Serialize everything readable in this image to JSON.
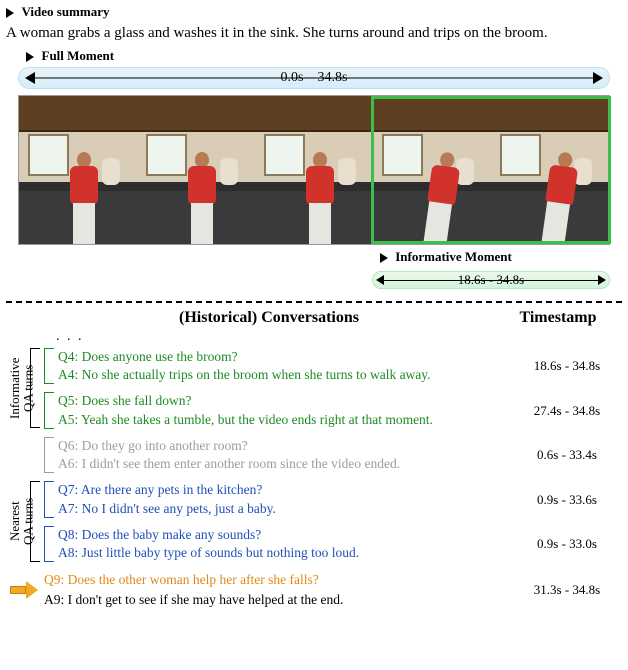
{
  "labels": {
    "video_summary": "Video summary",
    "full_moment": "Full Moment",
    "informative_moment": "Informative Moment"
  },
  "summary_text": "A woman grabs a glass and washes it in the sink. She turns around and trips on the broom.",
  "full_moment_range": "0.0s – 34.8s",
  "informative_moment_range": "18.6s - 34.8s",
  "columns": {
    "conversations": "(Historical) Conversations",
    "timestamp": "Timestamp"
  },
  "groups": {
    "informative_label": "Informative\nQA turns",
    "nearest_label": "Nearest\nQA turns"
  },
  "ellipsis": ". . .",
  "qa": [
    {
      "id": 4,
      "q_label": "Q4:",
      "q": "Does anyone use the broom?",
      "a_label": "A4:",
      "a": "No she actually trips on the broom when she turns to walk away.",
      "ts": "18.6s - 34.8s",
      "color": "c-green",
      "group": "informative"
    },
    {
      "id": 5,
      "q_label": "Q5:",
      "q": "Does she fall down?",
      "a_label": "A5:",
      "a": "Yeah she takes a tumble, but the video ends right at that moment.",
      "ts": "27.4s - 34.8s",
      "color": "c-green",
      "group": "informative"
    },
    {
      "id": 6,
      "q_label": "Q6:",
      "q": "Do they go into another room?",
      "a_label": "A6:",
      "a": "I didn't see them enter another room since the video ended.",
      "ts": "0.6s - 33.4s",
      "color": "c-gray",
      "group": "none"
    },
    {
      "id": 7,
      "q_label": "Q7:",
      "q": "Are there any pets in the kitchen?",
      "a_label": "A7:",
      "a": "No I didn't see any pets, just a baby.",
      "ts": "0.9s - 33.6s",
      "color": "c-blue",
      "group": "nearest"
    },
    {
      "id": 8,
      "q_label": "Q8:",
      "q": "Does the baby make any sounds?",
      "a_label": "A8:",
      "a": "Just little baby type of sounds but nothing too loud.",
      "ts": "0.9s - 33.0s",
      "color": "c-blue",
      "group": "nearest"
    }
  ],
  "final": {
    "q_label": "Q9:",
    "q": "Does the other woman help her after she falls?",
    "a_label": "A9:",
    "a": "I don't get to see if she may have helped at the end.",
    "ts": "31.3s - 34.8s"
  }
}
